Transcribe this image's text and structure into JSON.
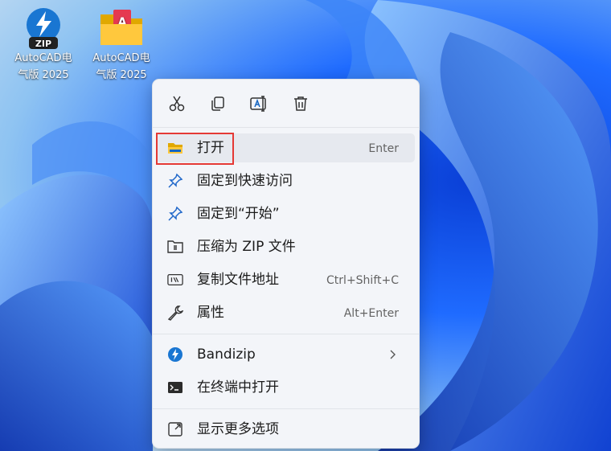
{
  "desktop": {
    "icons": [
      {
        "label_line1": "AutoCAD电",
        "label_line2": "气版 2025",
        "icon": "zip-archive-icon",
        "badge": "ZIP"
      },
      {
        "label_line1": "AutoCAD电",
        "label_line2": "气版 2025",
        "icon": "autocad-folder-icon",
        "badge": "A"
      }
    ]
  },
  "context_menu": {
    "toolbar": [
      {
        "icon": "cut-icon"
      },
      {
        "icon": "copy-icon"
      },
      {
        "icon": "rename-icon"
      },
      {
        "icon": "delete-icon"
      }
    ],
    "items": [
      {
        "label": "打开",
        "shortcut": "Enter",
        "icon": "folder-icon",
        "highlighted": true
      },
      {
        "label": "固定到快速访问",
        "icon": "pin-icon"
      },
      {
        "label": "固定到“开始”",
        "icon": "pin-icon"
      },
      {
        "label": "压缩为 ZIP 文件",
        "icon": "zip-folder-icon"
      },
      {
        "label": "复制文件地址",
        "shortcut": "Ctrl+Shift+C",
        "icon": "copy-path-icon"
      },
      {
        "label": "属性",
        "shortcut": "Alt+Enter",
        "icon": "wrench-icon"
      },
      {
        "label": "Bandizip",
        "icon": "bandizip-icon",
        "has_submenu": true
      },
      {
        "label": "在终端中打开",
        "icon": "terminal-icon"
      },
      {
        "label": "显示更多选项",
        "icon": "expand-icon"
      }
    ]
  },
  "colors": {
    "highlight_box": "#e53935",
    "menu_background": "#f3f5f9",
    "wallpaper_blue": "#1f6bff"
  }
}
